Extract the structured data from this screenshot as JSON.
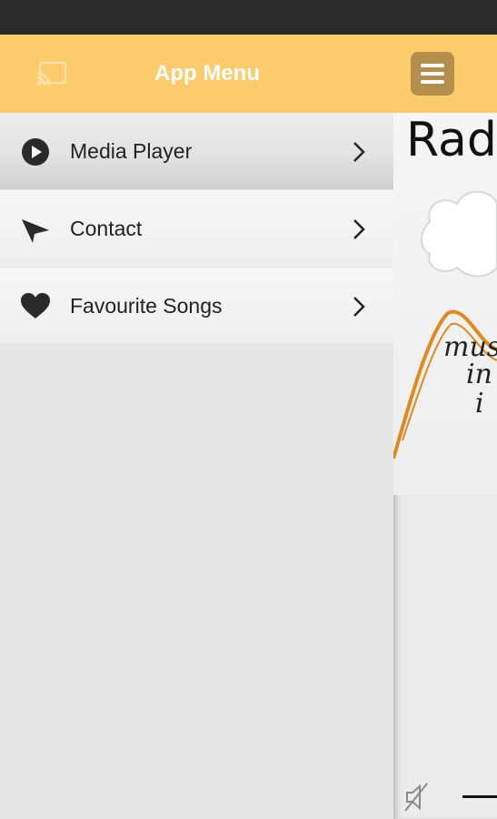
{
  "drawer": {
    "title": "App Menu",
    "cast_icon": "cast-icon",
    "items": [
      {
        "label": "Media Player",
        "icon": "play-circle-icon",
        "active": true
      },
      {
        "label": "Contact",
        "icon": "paper-plane-icon",
        "active": false
      },
      {
        "label": "Favourite Songs",
        "icon": "heart-icon",
        "active": false
      }
    ]
  },
  "main": {
    "menu_button_icon": "hamburger-icon",
    "logo": {
      "title": "Rad",
      "line1": "mus",
      "line2": "in",
      "line3": "i"
    },
    "player": {
      "mute_icon": "speaker-muted-icon"
    }
  },
  "colors": {
    "header": "#fccb6c",
    "menu_button": "#b38e4d",
    "drawer_bg": "#e6e6e6",
    "status_bar": "#2b2b2b",
    "logo_accent": "#e08a1e"
  }
}
